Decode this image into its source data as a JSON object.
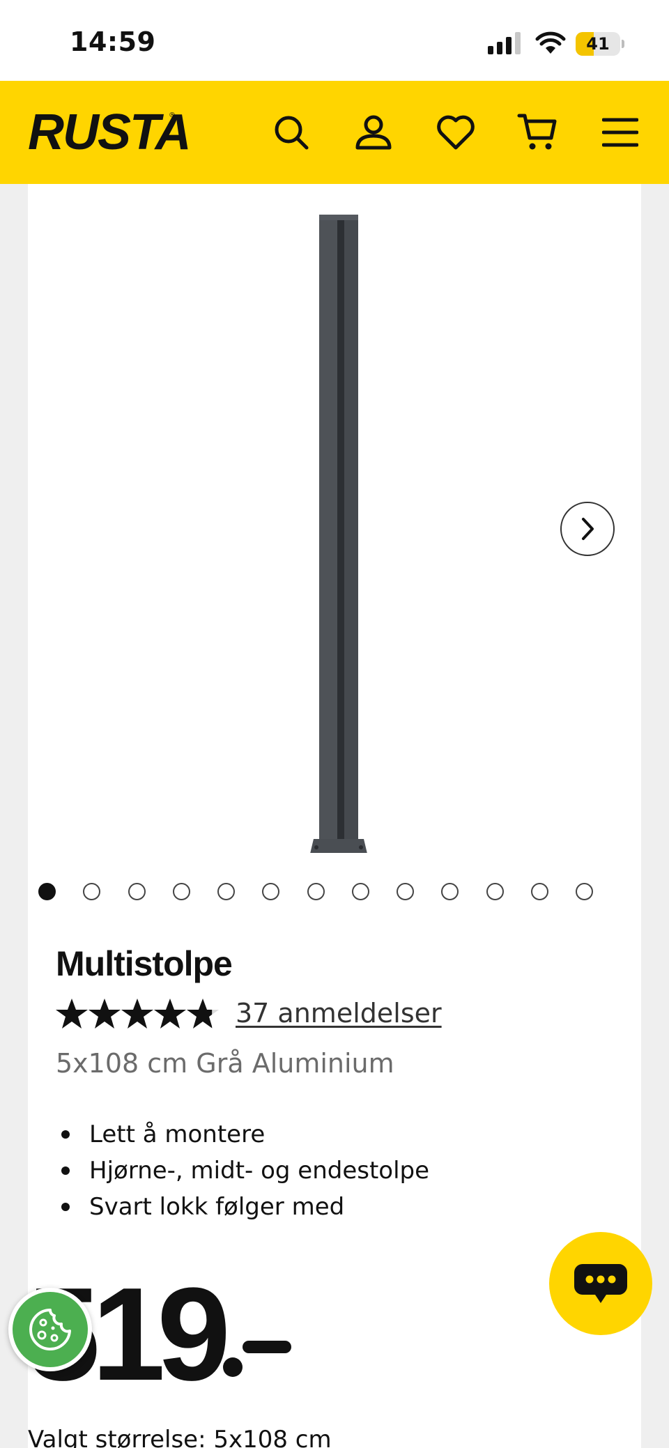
{
  "status": {
    "time": "14:59",
    "battery": "41",
    "battery_level": 0.41
  },
  "header": {
    "logo": "RUSTA",
    "icons": [
      "search-icon",
      "account-icon",
      "wishlist-heart-icon",
      "cart-icon",
      "menu-icon"
    ],
    "brand_color": "#ffd500"
  },
  "gallery": {
    "image_count": 13,
    "active_index": 0
  },
  "product": {
    "title": "Multistolpe",
    "rating": 4.8,
    "reviews_label": "37 anmeldelser",
    "subtitle": "5x108 cm Grå Aluminium",
    "bullets": [
      "Lett å montere",
      "Hjørne-, midt- og endestolpe",
      "Svart lokk følger med"
    ],
    "price": "519",
    "size_label": "Valgt størrelse:",
    "size_value": "5x108 cm"
  },
  "floating": {
    "chat": "chat-icon",
    "cookie": "cookie-icon"
  }
}
